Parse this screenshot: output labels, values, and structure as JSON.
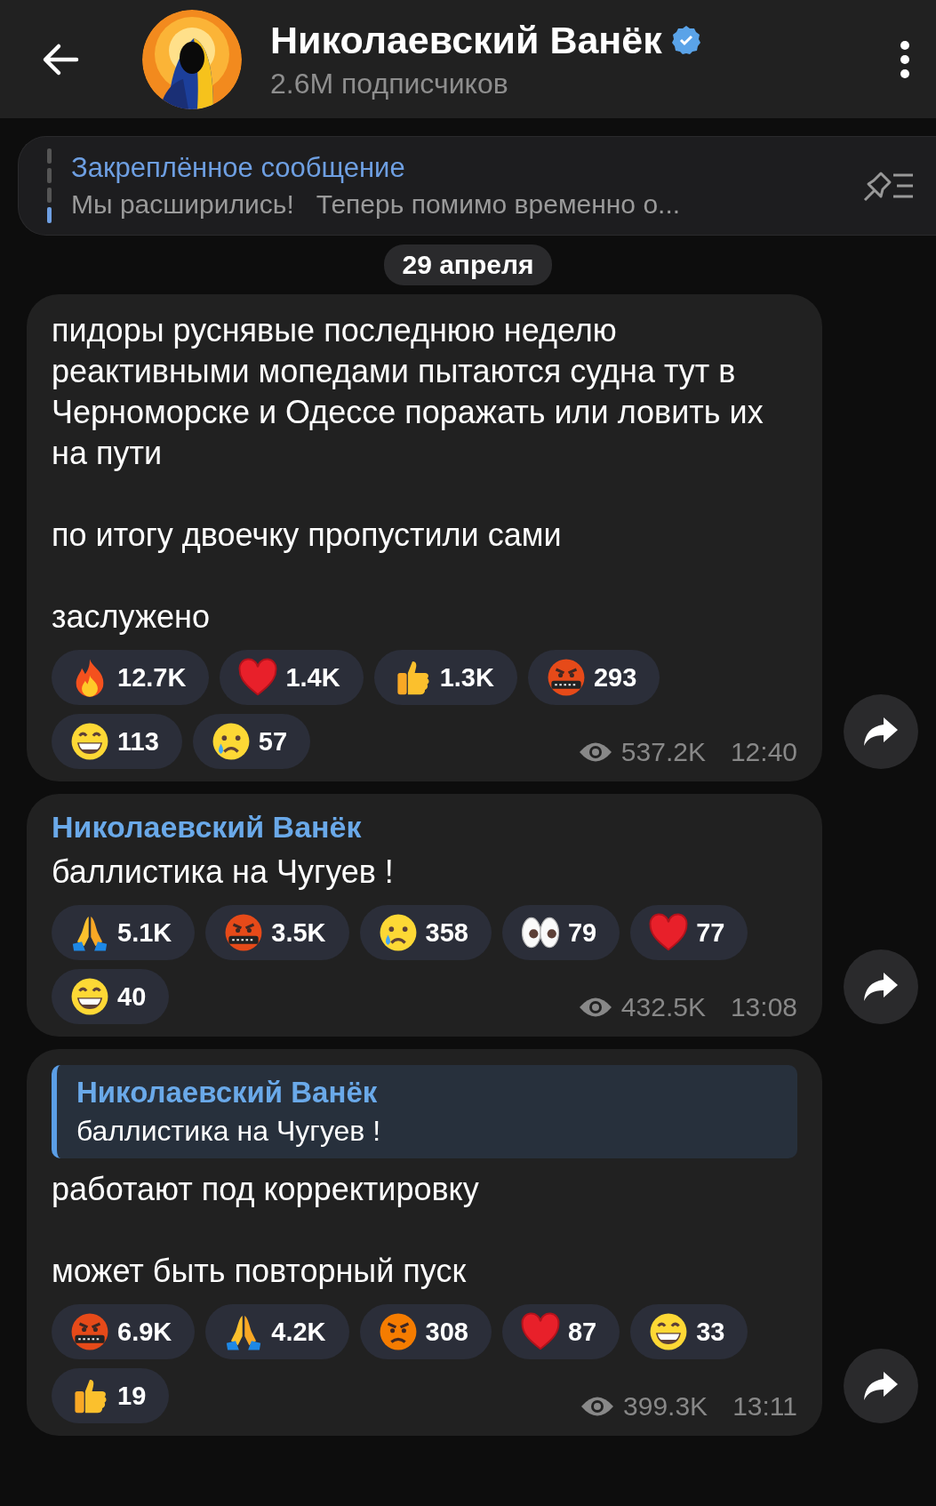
{
  "header": {
    "title": "Николаевский Ванёк",
    "subtitle": "2.6M подписчиков",
    "verified": true
  },
  "pinned": {
    "label": "Закреплённое сообщение",
    "text": "Мы расширились!   Теперь помимо временно о..."
  },
  "date": "29 апреля",
  "messages": [
    {
      "paragraphs": [
        "пидоры руснявые последнюю неделю реактивными мопедами пытаются судна тут в Черноморске и Одессе поражать или ловить их на пути",
        "по итогу двоечку пропустили сами",
        "заслужено"
      ],
      "reactions": [
        {
          "kind": "fire",
          "count": "12.7K"
        },
        {
          "kind": "heart",
          "count": "1.4K"
        },
        {
          "kind": "thumbs",
          "count": "1.3K"
        },
        {
          "kind": "cursing",
          "count": "293"
        },
        {
          "kind": "grin",
          "count": "113"
        },
        {
          "kind": "cry",
          "count": "57"
        }
      ],
      "views": "537.2K",
      "time": "12:40"
    },
    {
      "author": "Николаевский Ванёк",
      "paragraphs": [
        "баллистика на Чугуев !"
      ],
      "reactions": [
        {
          "kind": "pray",
          "count": "5.1K"
        },
        {
          "kind": "cursing",
          "count": "3.5K"
        },
        {
          "kind": "cry",
          "count": "358"
        },
        {
          "kind": "eyes",
          "count": "79"
        },
        {
          "kind": "heart",
          "count": "77"
        },
        {
          "kind": "grin",
          "count": "40"
        }
      ],
      "views": "432.5K",
      "time": "13:08"
    },
    {
      "reply": {
        "author": "Николаевский Ванёк",
        "text": "баллистика на Чугуев !"
      },
      "paragraphs": [
        "работают под корректировку",
        "может быть повторный пуск"
      ],
      "reactions": [
        {
          "kind": "cursing",
          "count": "6.9K"
        },
        {
          "kind": "pray",
          "count": "4.2K"
        },
        {
          "kind": "angry",
          "count": "308"
        },
        {
          "kind": "heart",
          "count": "87"
        },
        {
          "kind": "grin",
          "count": "33"
        },
        {
          "kind": "thumbs",
          "count": "19"
        }
      ],
      "views": "399.3K",
      "time": "13:11"
    }
  ]
}
